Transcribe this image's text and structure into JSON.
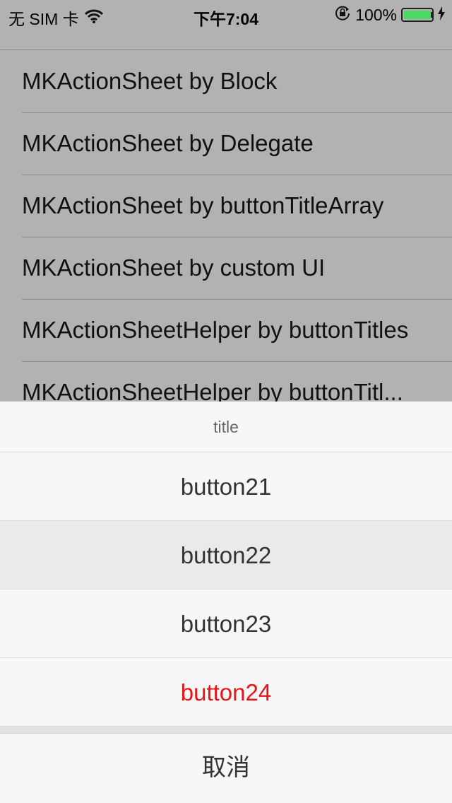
{
  "status_bar": {
    "carrier": "无 SIM 卡",
    "time": "下午7:04",
    "battery_percent": "100%",
    "battery_level": 1.0,
    "icons": [
      "wifi-icon",
      "orientation-lock-icon",
      "battery-icon",
      "charging-icon"
    ]
  },
  "list": {
    "items": [
      {
        "label": "MKActionSheet by Block"
      },
      {
        "label": "MKActionSheet by Delegate"
      },
      {
        "label": "MKActionSheet by buttonTitleArray"
      },
      {
        "label": "MKActionSheet by custom UI"
      },
      {
        "label": "MKActionSheetHelper by buttonTitles"
      },
      {
        "label": "MKActionSheetHelper by buttonTitl..."
      }
    ]
  },
  "action_sheet": {
    "title": "title",
    "buttons": [
      {
        "label": "button21",
        "color": "#333333",
        "highlighted": false
      },
      {
        "label": "button22",
        "color": "#333333",
        "highlighted": true
      },
      {
        "label": "button23",
        "color": "#333333",
        "highlighted": false
      },
      {
        "label": "button24",
        "color": "#e8141a",
        "highlighted": false
      }
    ],
    "cancel_label": "取消"
  },
  "colors": {
    "dim_overlay": "#b2b2b2",
    "sheet_background": "#f7f7f7",
    "destructive": "#e8141a",
    "battery": "#4cd964"
  }
}
